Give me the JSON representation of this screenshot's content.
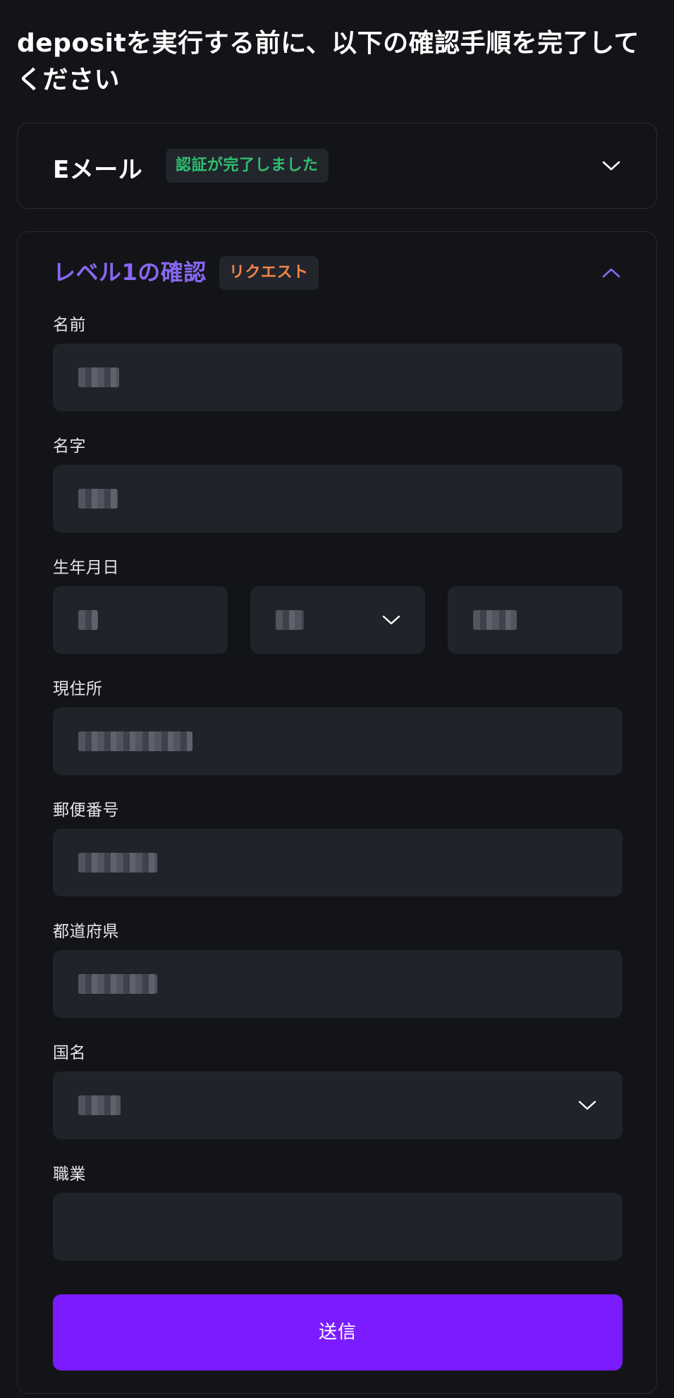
{
  "header": {
    "message": "depositを実行する前に、以下の確認手順を完了してください"
  },
  "email_section": {
    "title": "Eメール",
    "status_badge": "認証が完了しました"
  },
  "level1_section": {
    "title": "レベル1の確認",
    "status_badge": "リクエスト"
  },
  "form": {
    "first_name_label": "名前",
    "last_name_label": "名字",
    "birthdate_label": "生年月日",
    "address_label": "現住所",
    "postal_code_label": "郵便番号",
    "prefecture_label": "都道府県",
    "country_label": "国名",
    "occupation_label": "職業",
    "occupation_value": "",
    "submit_label": "送信"
  },
  "colors": {
    "background": "#131418",
    "card_border": "#2a2c33",
    "field_background": "#21232b",
    "verified_green": "#2fbf6f",
    "request_orange": "#f08548",
    "section_purple": "#8867f0",
    "submit_purple": "#7a1cff"
  },
  "icons": {
    "email_toggle": "chevron-down-icon",
    "level_toggle": "chevron-up-icon",
    "month_select": "chevron-down-icon",
    "country_select": "chevron-down-icon"
  }
}
